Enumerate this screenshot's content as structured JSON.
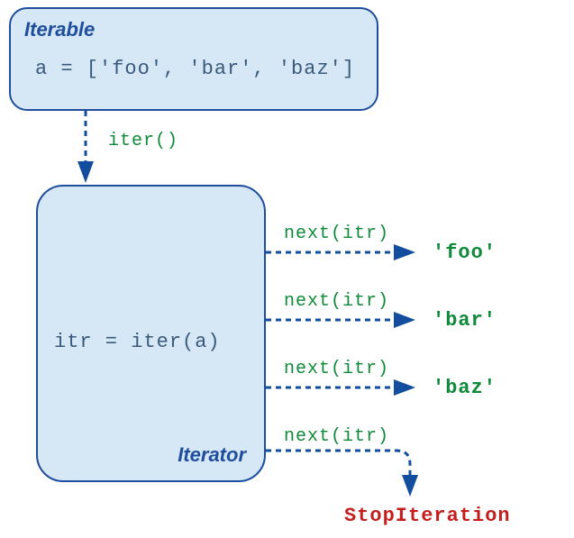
{
  "iterable": {
    "title": "Iterable",
    "code": "a = ['foo', 'bar', 'baz']"
  },
  "iterator": {
    "title": "Iterator",
    "code": "itr = iter(a)"
  },
  "iter_call": "iter()",
  "next_calls": [
    {
      "label": "next(itr)",
      "result": "'foo'"
    },
    {
      "label": "next(itr)",
      "result": "'bar'"
    },
    {
      "label": "next(itr)",
      "result": "'baz'"
    },
    {
      "label": "next(itr)",
      "result": "StopIteration"
    }
  ],
  "colors": {
    "box_fill": "#d6e7f5",
    "box_border": "#1f4e9c",
    "code_text": "#3a5a7a",
    "call_text": "#0f8a3a",
    "exception": "#c41e1e",
    "arrow": "#134d9e"
  }
}
